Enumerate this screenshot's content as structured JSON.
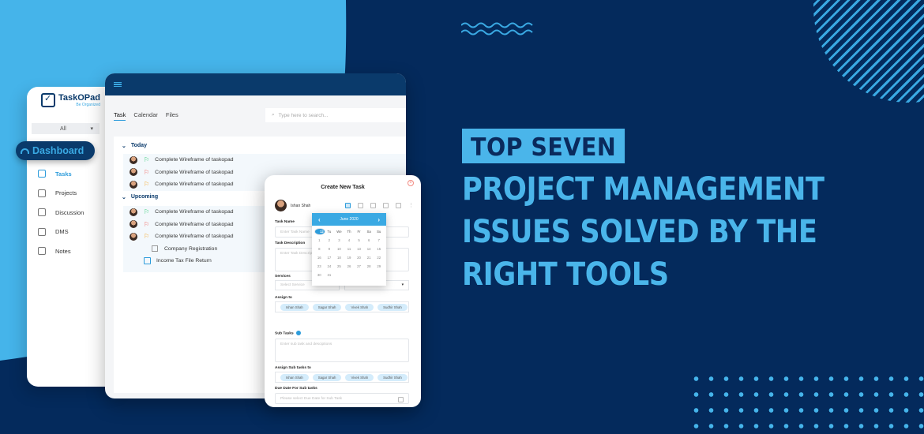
{
  "colors": {
    "background_dark": "#042a5c",
    "background_light": "#45b4ea",
    "accent": "#2d9cdb",
    "navy": "#0a3a6b"
  },
  "sidebar": {
    "logo_title": "TaskOPad",
    "logo_subtitle": "Be Organized",
    "filter_value": "All",
    "dashboard_label": "Dashboard",
    "items": [
      {
        "label": "Tasks",
        "icon": "clipboard-icon",
        "active": true
      },
      {
        "label": "Projects",
        "icon": "projects-icon",
        "active": false
      },
      {
        "label": "Discussion",
        "icon": "discussion-icon",
        "active": false
      },
      {
        "label": "DMS",
        "icon": "dms-icon",
        "active": false
      },
      {
        "label": "Notes",
        "icon": "notes-icon",
        "active": false
      }
    ]
  },
  "main": {
    "tabs": [
      {
        "label": "Task",
        "active": true
      },
      {
        "label": "Calendar",
        "active": false
      },
      {
        "label": "Files",
        "active": false
      }
    ],
    "search_placeholder": "Type here to search...",
    "groups": [
      {
        "title": "Today",
        "tasks": [
          {
            "title": "Complete Wireframe of taskopad",
            "flag_color": "#2ecc71"
          },
          {
            "title": "Complete Wireframe of taskopad",
            "flag_color": "#f0605a"
          },
          {
            "title": "Complete Wireframe of taskopad",
            "flag_color": "#f5a623"
          }
        ]
      },
      {
        "title": "Upcoming",
        "tasks": [
          {
            "title": "Complete Wireframe of taskopad",
            "flag_color": "#2ecc71"
          },
          {
            "title": "Complete Wireframe of taskopad",
            "flag_color": "#f0605a"
          },
          {
            "title": "Complete Wireframe of taskopad",
            "flag_color": "#f5a623"
          }
        ],
        "subtask": "Company Registration",
        "extra_task": "Income Tax File Return"
      }
    ]
  },
  "modal": {
    "title": "Create New Task",
    "user_name": "Ishan Shah",
    "task_name_label": "Task Name",
    "task_name_placeholder": "Enter Task Name",
    "task_description_label": "Task Description",
    "task_description_placeholder": "Enter Task Description",
    "services_label": "Services",
    "service_placeholder": "Select Service",
    "client_placeholder": "Select Client",
    "assign_to_label": "Assign to",
    "assignees": [
      "Ishan Shah",
      "Sagar Shah",
      "Vivek Shah",
      "Sudhir Shah"
    ],
    "sub_tasks_label": "Sub Tasks",
    "sub_tasks_placeholder": "Enter sub task and desciptions",
    "assign_sub_tasks_label": "Assign Sub tasks to",
    "sub_assignees": [
      "Ishan Shah",
      "Sagar Shah",
      "Vivek Shah",
      "Sudhir Shah"
    ],
    "due_date_label": "Due Date For Sub tasks",
    "due_date_placeholder": "Please select Due Date for Sub Task"
  },
  "calendar": {
    "month_label": "June 2020",
    "weekdays": [
      "Mo",
      "Tu",
      "We",
      "Th",
      "Fr",
      "Sa",
      "Su"
    ],
    "days": [
      1,
      2,
      3,
      4,
      5,
      6,
      7,
      8,
      9,
      10,
      11,
      12,
      13,
      14,
      15,
      16,
      17,
      18,
      19,
      20,
      21,
      22,
      23,
      24,
      25,
      26,
      27,
      28,
      29,
      30,
      31
    ],
    "selected_day": 12
  },
  "headline": {
    "tag": "TOP SEVEN",
    "lines": [
      "PROJECT MANAGEMENT",
      "ISSUES SOLVED BY THE",
      "RIGHT TOOLS"
    ]
  }
}
